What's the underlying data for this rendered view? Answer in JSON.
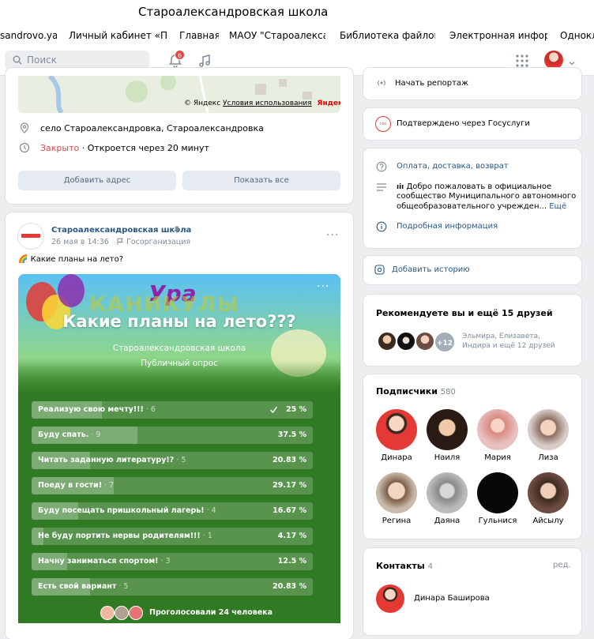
{
  "window": {
    "title": "Староалександровская школа"
  },
  "bookmarks": [
    "sandrovo.ya",
    "Личный кабинет «Пе",
    "Главная",
    "МАОУ \"Староалекса",
    "Библиотека файлов",
    "Электронная инфор",
    "Однокл"
  ],
  "header": {
    "search_placeholder": "Поиск",
    "notif_count": "6"
  },
  "map": {
    "copyright": "© Яндекс",
    "terms": "Условия использования",
    "brand": "Яндекс"
  },
  "location": {
    "address": "село Староалександровка, Староалександровка",
    "status": "Закрыто",
    "hours": " · Откроется через 20 минут",
    "add_address": "Добавить адрес",
    "show_all": "Показать все"
  },
  "post": {
    "author": "Староалександровская школа",
    "date": "26 мая в 14:36",
    "org": "Госорганизация",
    "text": "Какие планы на лето?",
    "emoji": "🌈"
  },
  "poll": {
    "banner_top": "Ура",
    "banner_bottom": "КАНИКУЛЫ",
    "question": "Какие планы на лето???",
    "author": "Староалександровская школа",
    "kind": "Публичный опрос",
    "voted": "Проголосовали 24 человека",
    "options": [
      {
        "text": "Реализую свою мечту!!!",
        "count": " · 6",
        "percent": "25 %",
        "fraction": 0.25,
        "mine": true
      },
      {
        "text": "Буду спать.",
        "count": " · 9",
        "percent": "37.5 %",
        "fraction": 0.375,
        "mine": false
      },
      {
        "text": "Читать заданную литературу!?",
        "count": " · 5",
        "percent": "20.83 %",
        "fraction": 0.2083,
        "mine": false
      },
      {
        "text": "Поеду в гости!",
        "count": " · 7",
        "percent": "29.17 %",
        "fraction": 0.2917,
        "mine": false
      },
      {
        "text": "Буду посещать пришкольный лагерь!",
        "count": " · 4",
        "percent": "16.67 %",
        "fraction": 0.1667,
        "mine": false
      },
      {
        "text": "Не буду портить нервы родителям!!!",
        "count": " · 1",
        "percent": "4.17 %",
        "fraction": 0.0417,
        "mine": false
      },
      {
        "text": "Начну заниматься спортом!",
        "count": " · 3",
        "percent": "12.5 %",
        "fraction": 0.125,
        "mine": false
      },
      {
        "text": "Есть свой вариант",
        "count": " · 5",
        "percent": "20.83 %",
        "fraction": 0.2083,
        "mine": false
      }
    ]
  },
  "right": {
    "report": "Начать репортаж",
    "gosuslugi": "Подтверждено через Госуслуги",
    "payment": "Оплата, доставка, возврат",
    "welcome": [
      "Добро пожаловать в официальное",
      "сообщество Муниципального автономного",
      "общеобразовательного учрежден..."
    ],
    "more": "Ещё",
    "details": "Подробная информация",
    "add_story": "Добавить историю",
    "recommend": {
      "title": "Рекомендуете вы и ещё 15 друзей",
      "plus": "+12",
      "names": "Эльмира, Елизавета,",
      "names2": "Индира и ещё 12 друзей"
    },
    "subs": {
      "title": "Подписчики",
      "count": "580",
      "names": [
        "Динара",
        "Наиля",
        "Мария",
        "Лиза",
        "Регина",
        "Даяна",
        "Гульнися",
        "Айсылу"
      ]
    },
    "contacts": {
      "title": "Контакты",
      "count": "4",
      "edit": "ред.",
      "person": "Динара Баширова"
    }
  }
}
